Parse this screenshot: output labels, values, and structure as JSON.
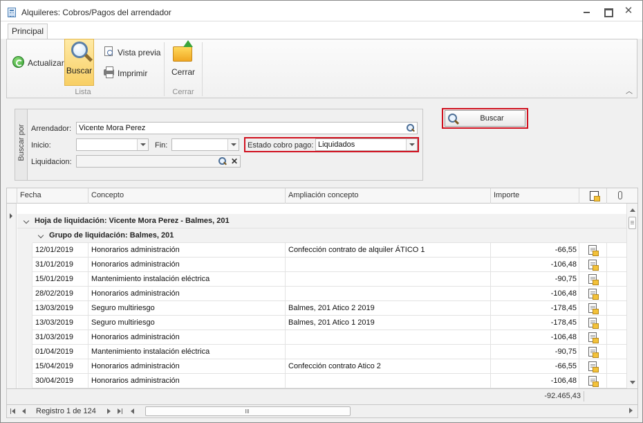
{
  "window": {
    "title": "Alquileres: Cobros/Pagos del arrendador"
  },
  "ribbon": {
    "tab": "Principal",
    "actualizar": "Actualizar",
    "buscar": "Buscar",
    "vista_previa": "Vista previa",
    "imprimir": "Imprimir",
    "cerrar": "Cerrar",
    "group_lista": "Lista",
    "group_cerrar": "Cerrar"
  },
  "search": {
    "side_label": "Buscar por",
    "arrendador_label": "Arrendador:",
    "arrendador_value": "Vicente Mora Perez",
    "inicio_label": "Inicio:",
    "inicio_value": "",
    "fin_label": "Fin:",
    "fin_value": "",
    "estado_label": "Estado cobro pago:",
    "estado_value": "Liquidados",
    "liquidacion_label": "Liquidacion:",
    "liquidacion_value": "",
    "buscar_button": "Buscar"
  },
  "grid": {
    "columns": [
      "Fecha",
      "Concepto",
      "Ampliación concepto",
      "Importe"
    ],
    "group1": "Hoja de liquidación: Vicente Mora Perez - Balmes, 201",
    "group2": "Grupo de liquidación: Balmes, 201",
    "rows": [
      {
        "fecha": "12/01/2019",
        "concepto": "Honorarios administración",
        "ampliacion": "Confección contrato de alquiler ÁTICO 1",
        "importe": "-66,55"
      },
      {
        "fecha": "31/01/2019",
        "concepto": "Honorarios administración",
        "ampliacion": "",
        "importe": "-106,48"
      },
      {
        "fecha": "15/01/2019",
        "concepto": "Mantenimiento instalación eléctrica",
        "ampliacion": "",
        "importe": "-90,75"
      },
      {
        "fecha": "28/02/2019",
        "concepto": "Honorarios administración",
        "ampliacion": "",
        "importe": "-106,48"
      },
      {
        "fecha": "13/03/2019",
        "concepto": "Seguro multiriesgo",
        "ampliacion": "Balmes, 201 Atico 2 2019",
        "importe": "-178,45"
      },
      {
        "fecha": "13/03/2019",
        "concepto": "Seguro multiriesgo",
        "ampliacion": "Balmes, 201 Atico 1 2019",
        "importe": "-178,45"
      },
      {
        "fecha": "31/03/2019",
        "concepto": "Honorarios administración",
        "ampliacion": "",
        "importe": "-106,48"
      },
      {
        "fecha": "01/04/2019",
        "concepto": "Mantenimiento instalación eléctrica",
        "ampliacion": "",
        "importe": "-90,75"
      },
      {
        "fecha": "15/04/2019",
        "concepto": "Honorarios administración",
        "ampliacion": "Confección contrato Atico 2",
        "importe": "-66,55"
      },
      {
        "fecha": "30/04/2019",
        "concepto": "Honorarios administración",
        "ampliacion": "",
        "importe": "-106,48"
      }
    ],
    "total": "-92.465,43"
  },
  "navigator": {
    "record_text": "Registro 1 de 124"
  },
  "colors": {
    "highlight_border": "#d0101e",
    "ribbon_active": "#f8cf65"
  }
}
